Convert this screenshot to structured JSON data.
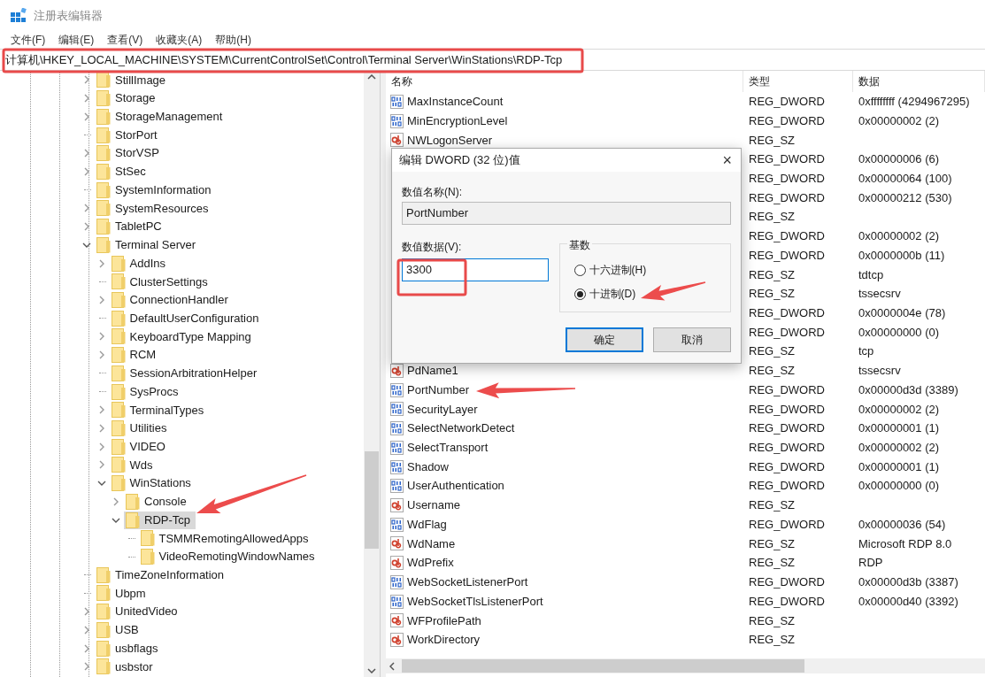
{
  "window": {
    "title": "注册表编辑器"
  },
  "menu": [
    "文件(F)",
    "编辑(E)",
    "查看(V)",
    "收藏夹(A)",
    "帮助(H)"
  ],
  "address_bar": {
    "path": "计算机\\HKEY_LOCAL_MACHINE\\SYSTEM\\CurrentControlSet\\Control\\Terminal Server\\WinStations\\RDP-Tcp"
  },
  "tree": {
    "items": [
      {
        "label": "StillImage",
        "kind": "collapsed",
        "selected": false
      },
      {
        "label": "Storage",
        "kind": "collapsed",
        "selected": false
      },
      {
        "label": "StorageManagement",
        "kind": "collapsed",
        "selected": false
      },
      {
        "label": "StorPort",
        "kind": "leaf",
        "selected": false
      },
      {
        "label": "StorVSP",
        "kind": "collapsed",
        "selected": false
      },
      {
        "label": "StSec",
        "kind": "collapsed",
        "selected": false
      },
      {
        "label": "SystemInformation",
        "kind": "leaf",
        "selected": false
      },
      {
        "label": "SystemResources",
        "kind": "collapsed",
        "selected": false
      },
      {
        "label": "TabletPC",
        "kind": "collapsed",
        "selected": false
      },
      {
        "label": "Terminal Server",
        "kind": "expanded",
        "selected": false,
        "children": [
          {
            "label": "AddIns",
            "kind": "collapsed",
            "selected": false
          },
          {
            "label": "ClusterSettings",
            "kind": "leaf",
            "selected": false
          },
          {
            "label": "ConnectionHandler",
            "kind": "collapsed",
            "selected": false
          },
          {
            "label": "DefaultUserConfiguration",
            "kind": "leaf",
            "selected": false
          },
          {
            "label": "KeyboardType Mapping",
            "kind": "collapsed",
            "selected": false
          },
          {
            "label": "RCM",
            "kind": "collapsed",
            "selected": false
          },
          {
            "label": "SessionArbitrationHelper",
            "kind": "leaf",
            "selected": false
          },
          {
            "label": "SysProcs",
            "kind": "leaf",
            "selected": false
          },
          {
            "label": "TerminalTypes",
            "kind": "collapsed",
            "selected": false
          },
          {
            "label": "Utilities",
            "kind": "collapsed",
            "selected": false
          },
          {
            "label": "VIDEO",
            "kind": "collapsed",
            "selected": false
          },
          {
            "label": "Wds",
            "kind": "collapsed",
            "selected": false
          },
          {
            "label": "WinStations",
            "kind": "expanded",
            "selected": false,
            "children": [
              {
                "label": "Console",
                "kind": "collapsed",
                "selected": false
              },
              {
                "label": "RDP-Tcp",
                "kind": "expanded",
                "selected": true,
                "children": [
                  {
                    "label": "TSMMRemotingAllowedApps",
                    "kind": "leaf",
                    "selected": false
                  },
                  {
                    "label": "VideoRemotingWindowNames",
                    "kind": "leaf",
                    "selected": false
                  }
                ]
              }
            ]
          }
        ]
      },
      {
        "label": "TimeZoneInformation",
        "kind": "leaf",
        "selected": false
      },
      {
        "label": "Ubpm",
        "kind": "leaf",
        "selected": false
      },
      {
        "label": "UnitedVideo",
        "kind": "collapsed",
        "selected": false
      },
      {
        "label": "USB",
        "kind": "collapsed",
        "selected": false
      },
      {
        "label": "usbflags",
        "kind": "collapsed",
        "selected": false
      },
      {
        "label": "usbstor",
        "kind": "collapsed",
        "selected": false
      }
    ]
  },
  "values": {
    "columns": [
      "名称",
      "类型",
      "数据"
    ],
    "rows": [
      {
        "name": "MaxInstanceCount",
        "type": "REG_DWORD",
        "data": "0xffffffff (4294967295)"
      },
      {
        "name": "MinEncryptionLevel",
        "type": "REG_DWORD",
        "data": "0x00000002 (2)"
      },
      {
        "name": "NWLogonServer",
        "type": "REG_SZ"
      },
      {
        "type": "REG_DWORD",
        "data": "0x00000006 (6)"
      },
      {
        "type": "REG_DWORD",
        "data": "0x00000064 (100)"
      },
      {
        "type": "REG_DWORD",
        "data": "0x00000212 (530)"
      },
      {
        "type": "REG_SZ"
      },
      {
        "type": "REG_DWORD",
        "data": "0x00000002 (2)"
      },
      {
        "type": "REG_DWORD",
        "data": "0x0000000b (11)"
      },
      {
        "type": "REG_SZ",
        "data": "tdtcp"
      },
      {
        "type": "REG_SZ",
        "data": "tssecsrv"
      },
      {
        "type": "REG_DWORD",
        "data": "0x0000004e (78)"
      },
      {
        "type": "REG_DWORD",
        "data": "0x00000000 (0)"
      },
      {
        "type": "REG_SZ",
        "data": "tcp"
      },
      {
        "name": "PdName1",
        "type": "REG_SZ",
        "data": "tssecsrv"
      },
      {
        "name": "PortNumber",
        "type": "REG_DWORD",
        "data": "0x00000d3d (3389)"
      },
      {
        "name": "SecurityLayer",
        "type": "REG_DWORD",
        "data": "0x00000002 (2)"
      },
      {
        "name": "SelectNetworkDetect",
        "type": "REG_DWORD",
        "data": "0x00000001 (1)"
      },
      {
        "name": "SelectTransport",
        "type": "REG_DWORD",
        "data": "0x00000002 (2)"
      },
      {
        "name": "Shadow",
        "type": "REG_DWORD",
        "data": "0x00000001 (1)"
      },
      {
        "name": "UserAuthentication",
        "type": "REG_DWORD",
        "data": "0x00000000 (0)"
      },
      {
        "name": "Username",
        "type": "REG_SZ"
      },
      {
        "name": "WdFlag",
        "type": "REG_DWORD",
        "data": "0x00000036 (54)"
      },
      {
        "name": "WdName",
        "type": "REG_SZ",
        "data": "Microsoft RDP 8.0"
      },
      {
        "name": "WdPrefix",
        "type": "REG_SZ",
        "data": "RDP"
      },
      {
        "name": "WebSocketListenerPort",
        "type": "REG_DWORD",
        "data": "0x00000d3b (3387)"
      },
      {
        "name": "WebSocketTlsListenerPort",
        "type": "REG_DWORD",
        "data": "0x00000d40 (3392)"
      },
      {
        "name": "WFProfilePath",
        "type": "REG_SZ"
      },
      {
        "name": "WorkDirectory",
        "type": "REG_SZ"
      }
    ]
  },
  "dialog": {
    "title": "编辑 DWORD (32 位)值",
    "close": "×",
    "name_label": "数值名称(N):",
    "name_value": "PortNumber",
    "data_label": "数值数据(V):",
    "data_value": "3300",
    "base_label": "基数",
    "base_options": [
      {
        "label": "十六进制(H)",
        "selected": false
      },
      {
        "label": "十进制(D)",
        "selected": true
      }
    ],
    "buttons": [
      {
        "label": "确定",
        "default": true
      },
      {
        "label": "取消",
        "default": false
      }
    ]
  }
}
